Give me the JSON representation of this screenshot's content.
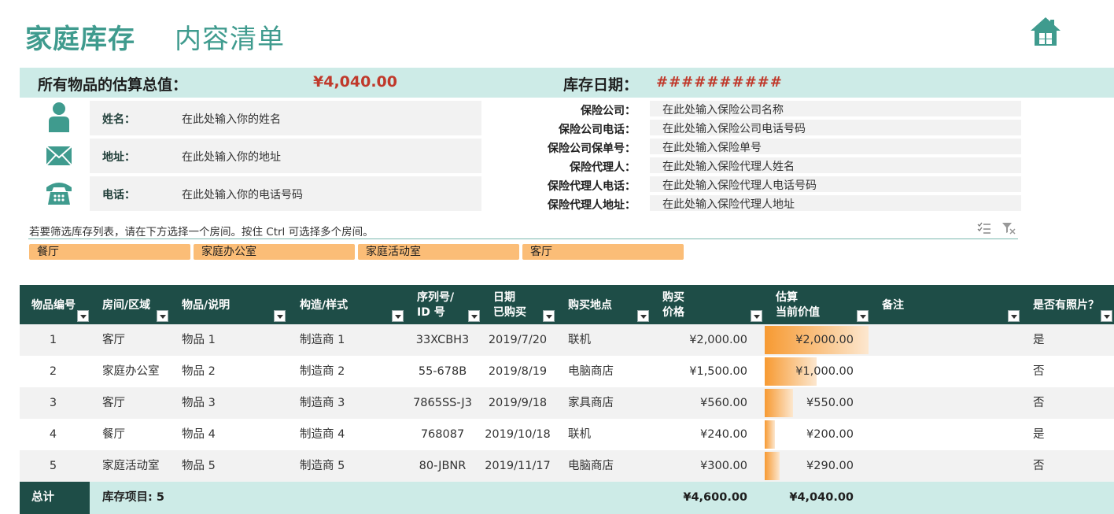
{
  "header": {
    "title": "家庭库存",
    "subtitle": "内容清单",
    "home_icon": "home-icon"
  },
  "summary": {
    "total_label": "所有物品的估算总值：",
    "total_value": "¥4,040.00",
    "date_label": "库存日期：",
    "date_value": "##########"
  },
  "personal": [
    {
      "icon": "person-icon",
      "label": "姓名：",
      "value": "在此处输入你的姓名"
    },
    {
      "icon": "mail-icon",
      "label": "地址：",
      "value": "在此处输入你的地址"
    },
    {
      "icon": "phone-icon",
      "label": "电话：",
      "value": "在此处输入你的电话号码"
    }
  ],
  "insurance": [
    {
      "label": "保险公司：",
      "value": "在此处输入保险公司名称"
    },
    {
      "label": "保险公司电话：",
      "value": "在此处输入保险公司电话号码"
    },
    {
      "label": "保险公司保单号：",
      "value": "在此处输入保险单号"
    },
    {
      "label": "保险代理人：",
      "value": "在此处输入保险代理人姓名"
    },
    {
      "label": "保险代理人电话：",
      "value": "在此处输入保险代理人电话号码"
    },
    {
      "label": "保险代理人地址：",
      "value": "在此处输入保险代理人地址"
    }
  ],
  "filter": {
    "hint": "若要筛选库存列表，请在下方选择一个房间。按住 Ctrl 可选择多个房间。",
    "rooms": [
      "餐厅",
      "家庭办公室",
      "家庭活动室",
      "客厅"
    ]
  },
  "table": {
    "headers": [
      {
        "line1": "物品编号",
        "line2": ""
      },
      {
        "line1": "房间/区域",
        "line2": ""
      },
      {
        "line1": "物品/说明",
        "line2": ""
      },
      {
        "line1": "构造/样式",
        "line2": ""
      },
      {
        "line1": "序列号/",
        "line2": "ID 号"
      },
      {
        "line1": "日期",
        "line2": "已购买"
      },
      {
        "line1": "购买地点",
        "line2": ""
      },
      {
        "line1": "购买",
        "line2": "价格"
      },
      {
        "line1": "估算",
        "line2": "当前价值"
      },
      {
        "line1": "备注",
        "line2": ""
      },
      {
        "line1": "是否有照片？",
        "line2": ""
      }
    ],
    "rows": [
      {
        "id": "1",
        "room": "客厅",
        "item": "物品 1",
        "make": "制造商 1",
        "serial": "33XCBH3",
        "date": "2019/7/20",
        "place": "联机",
        "price": "¥2,000.00",
        "value": "¥2,000.00",
        "value_ratio": 1.0,
        "notes": "",
        "photo": "是"
      },
      {
        "id": "2",
        "room": "家庭办公室",
        "item": "物品 2",
        "make": "制造商 2",
        "serial": "55-678B",
        "date": "2019/8/19",
        "place": "电脑商店",
        "price": "¥1,500.00",
        "value": "¥1,000.00",
        "value_ratio": 0.5,
        "notes": "",
        "photo": "否"
      },
      {
        "id": "3",
        "room": "客厅",
        "item": "物品 3",
        "make": "制造商 3",
        "serial": "7865SS-J3",
        "date": "2019/9/18",
        "place": "家具商店",
        "price": "¥560.00",
        "value": "¥550.00",
        "value_ratio": 0.275,
        "notes": "",
        "photo": "否"
      },
      {
        "id": "4",
        "room": "餐厅",
        "item": "物品 4",
        "make": "制造商 4",
        "serial": "768087",
        "date": "2019/10/18",
        "place": "联机",
        "price": "¥240.00",
        "value": "¥200.00",
        "value_ratio": 0.1,
        "notes": "",
        "photo": "是"
      },
      {
        "id": "5",
        "room": "家庭活动室",
        "item": "物品 5",
        "make": "制造商 5",
        "serial": "80-JBNR",
        "date": "2019/11/17",
        "place": "电脑商店",
        "price": "¥300.00",
        "value": "¥290.00",
        "value_ratio": 0.145,
        "notes": "",
        "photo": "否"
      }
    ],
    "footer": {
      "label": "总计",
      "count": "库存项目: 5",
      "price_total": "¥4,600.00",
      "value_total": "¥4,040.00"
    }
  }
}
